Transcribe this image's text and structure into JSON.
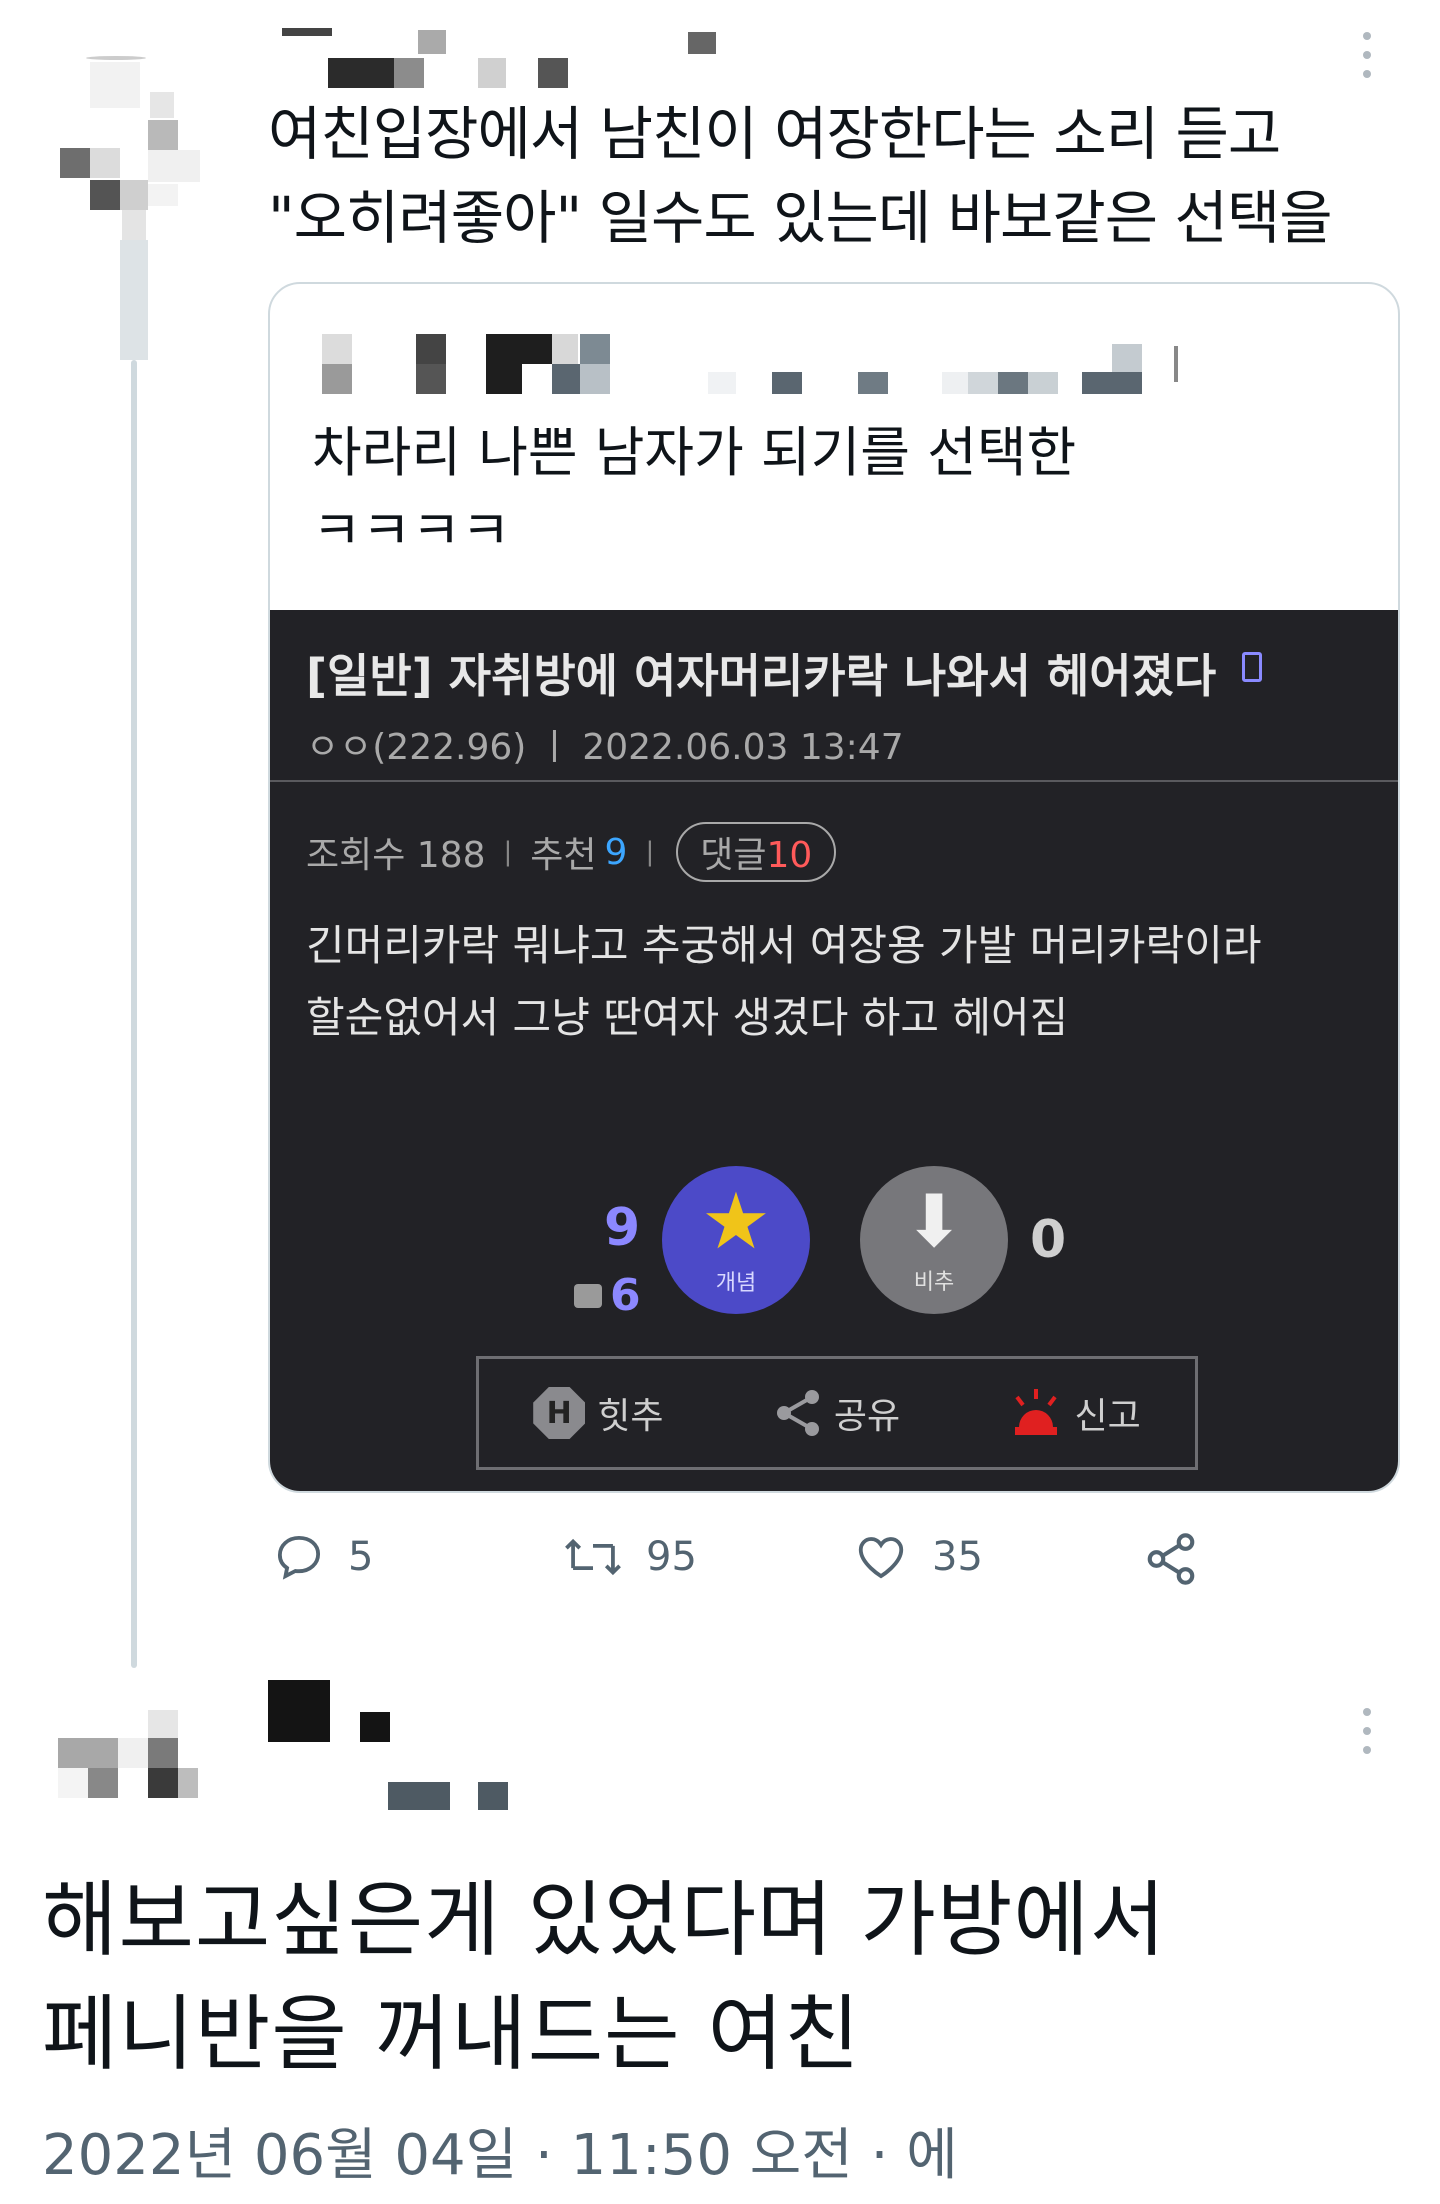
{
  "reply_tweet": {
    "text_line1": "여친입장에서 남친이 여장한다는 소리 듣고",
    "text_line2": "\"오히려좋아\" 일수도 있는데 바보같은 선택을",
    "quoted_tweet": {
      "text": "차라리 나쁜 남자가 되기를 선택한",
      "text_line2": "ㅋㅋㅋㅋ",
      "image": {
        "post_title": "[일반] 자취방에 여자머리카락 나와서 헤어졌다",
        "post_meta": "ㅇㅇ(222.96) ㅣ 2022.06.03 13:47",
        "views_label": "조회수 188",
        "recommend_label": "추천",
        "recommend_value": "9",
        "comment_label": "댓글",
        "comment_value": "10",
        "body_line1": "긴머리카락 뭐냐고 추궁해서 여장용 가발 머리카락이라",
        "body_line2": "할순없어서 그냥 딴여자 생겼다 하고 헤어짐",
        "upvote_count": "9",
        "upvote_fixed": "6",
        "upvote_label": "개념",
        "downvote_label": "비추",
        "downvote_count": "0",
        "action_hit": "힛추",
        "action_hit_icon_letter": "H",
        "action_share": "공유",
        "action_report": "신고"
      }
    },
    "actions": {
      "replies": "5",
      "retweets": "95",
      "likes": "35"
    }
  },
  "main_tweet": {
    "text_line1": "해보고싶은게 있었다며 가방에서",
    "text_line2": "페니반을 꺼내드는 여친",
    "timestamp": "2022년 06월 04일 · 11:50 오전 · 에"
  },
  "colors": {
    "text_primary": "#0f1419",
    "text_secondary": "#536471",
    "border": "#cfd9de",
    "dark_panel": "#222226",
    "upvote_purple": "#4c4ac8",
    "recommend_blue": "#3ca6ff",
    "comment_red": "#ff5a5a"
  },
  "icons": [
    "reply-icon",
    "retweet-icon",
    "like-icon",
    "share-icon",
    "more-icon",
    "star-icon",
    "down-arrow-icon",
    "hit-icon",
    "siren-icon"
  ]
}
